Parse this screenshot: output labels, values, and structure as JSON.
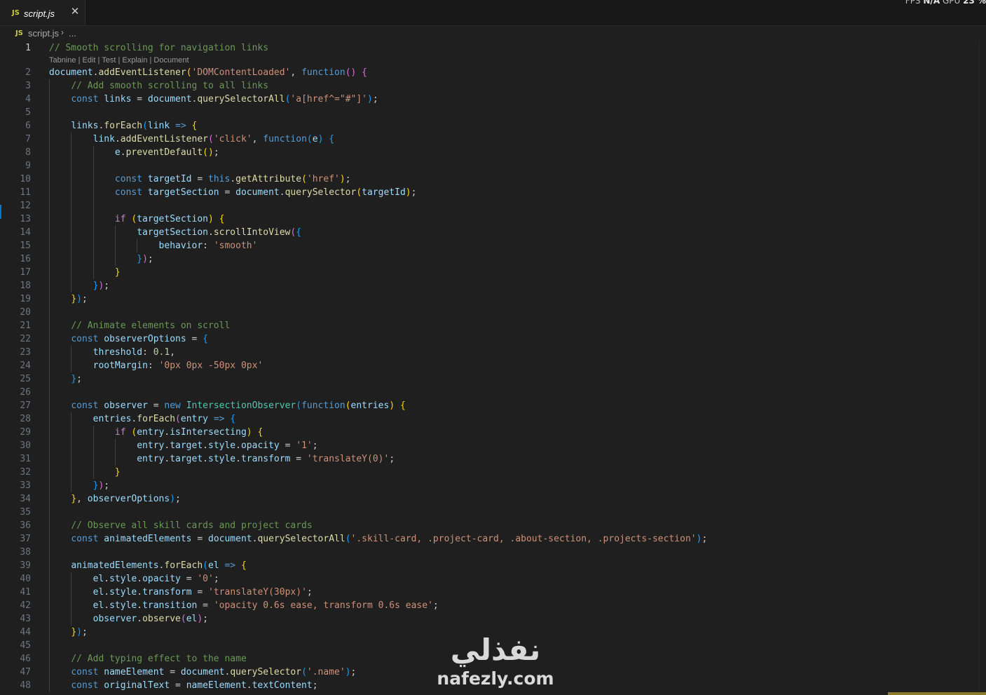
{
  "tab": {
    "label": "script.js",
    "icon": "JS",
    "close": "✕"
  },
  "overlay": {
    "fps_label": "FPS",
    "fps_value": "N/A",
    "gpu_label": "GPU",
    "gpu_value": "23 %"
  },
  "breadcrumb": {
    "icon": "JS",
    "file": "script.js",
    "separator": "›",
    "more": "..."
  },
  "codelens": "Tabnine | Edit | Test | Explain | Document",
  "watermark": {
    "arabic": "نفذلي",
    "latin": "nafezly.com"
  },
  "colors": {
    "comment": "#6a9955",
    "keyword": "#569cd6",
    "function": "#dcdcaa",
    "variable": "#9cdcfe",
    "string": "#ce9178",
    "number": "#b5cea8",
    "class": "#4ec9b0",
    "control": "#c586c0",
    "bracket_1": "#ffd700",
    "bracket_2": "#da70d6",
    "bracket_3": "#179fff",
    "text": "#cccccc"
  },
  "lines": [
    {
      "n": "1",
      "t": [
        [
          "com",
          "// Smooth scrolling for navigation links"
        ]
      ]
    },
    {
      "n": "2",
      "t": [
        [
          "var",
          "document"
        ],
        [
          "txt",
          "."
        ],
        [
          "fn",
          "addEventListener"
        ],
        [
          "b1",
          "("
        ],
        [
          "str",
          "'DOMContentLoaded'"
        ],
        [
          "txt",
          ", "
        ],
        [
          "kw",
          "function"
        ],
        [
          "b2",
          "()"
        ],
        [
          "txt",
          " "
        ],
        [
          "b2",
          "{"
        ]
      ]
    },
    {
      "n": "3",
      "t": [
        [
          "txt",
          "    "
        ],
        [
          "com",
          "// Add smooth scrolling to all links"
        ]
      ]
    },
    {
      "n": "4",
      "t": [
        [
          "txt",
          "    "
        ],
        [
          "kw",
          "const"
        ],
        [
          "txt",
          " "
        ],
        [
          "var",
          "links"
        ],
        [
          "txt",
          " = "
        ],
        [
          "var",
          "document"
        ],
        [
          "txt",
          "."
        ],
        [
          "fn",
          "querySelectorAll"
        ],
        [
          "b3",
          "("
        ],
        [
          "str",
          "'a[href^=\"#\"]'"
        ],
        [
          "b3",
          ")"
        ],
        [
          "txt",
          ";"
        ]
      ]
    },
    {
      "n": "5",
      "t": []
    },
    {
      "n": "6",
      "t": [
        [
          "txt",
          "    "
        ],
        [
          "var",
          "links"
        ],
        [
          "txt",
          "."
        ],
        [
          "fn",
          "forEach"
        ],
        [
          "b3",
          "("
        ],
        [
          "var",
          "link"
        ],
        [
          "txt",
          " "
        ],
        [
          "kw",
          "=>"
        ],
        [
          "txt",
          " "
        ],
        [
          "b1",
          "{"
        ]
      ]
    },
    {
      "n": "7",
      "t": [
        [
          "txt",
          "        "
        ],
        [
          "var",
          "link"
        ],
        [
          "txt",
          "."
        ],
        [
          "fn",
          "addEventListener"
        ],
        [
          "b2",
          "("
        ],
        [
          "str",
          "'click'"
        ],
        [
          "txt",
          ", "
        ],
        [
          "kw",
          "function"
        ],
        [
          "b3",
          "("
        ],
        [
          "var",
          "e"
        ],
        [
          "b3",
          ")"
        ],
        [
          "txt",
          " "
        ],
        [
          "b3",
          "{"
        ]
      ]
    },
    {
      "n": "8",
      "t": [
        [
          "txt",
          "            "
        ],
        [
          "var",
          "e"
        ],
        [
          "txt",
          "."
        ],
        [
          "fn",
          "preventDefault"
        ],
        [
          "b1",
          "()"
        ],
        [
          "txt",
          ";"
        ]
      ]
    },
    {
      "n": "9",
      "t": []
    },
    {
      "n": "10",
      "t": [
        [
          "txt",
          "            "
        ],
        [
          "kw",
          "const"
        ],
        [
          "txt",
          " "
        ],
        [
          "var",
          "targetId"
        ],
        [
          "txt",
          " = "
        ],
        [
          "kw",
          "this"
        ],
        [
          "txt",
          "."
        ],
        [
          "fn",
          "getAttribute"
        ],
        [
          "b1",
          "("
        ],
        [
          "str",
          "'href'"
        ],
        [
          "b1",
          ")"
        ],
        [
          "txt",
          ";"
        ]
      ]
    },
    {
      "n": "11",
      "t": [
        [
          "txt",
          "            "
        ],
        [
          "kw",
          "const"
        ],
        [
          "txt",
          " "
        ],
        [
          "var",
          "targetSection"
        ],
        [
          "txt",
          " = "
        ],
        [
          "var",
          "document"
        ],
        [
          "txt",
          "."
        ],
        [
          "fn",
          "querySelector"
        ],
        [
          "b1",
          "("
        ],
        [
          "var",
          "targetId"
        ],
        [
          "b1",
          ")"
        ],
        [
          "txt",
          ";"
        ]
      ]
    },
    {
      "n": "12",
      "t": []
    },
    {
      "n": "13",
      "t": [
        [
          "txt",
          "            "
        ],
        [
          "ctl",
          "if"
        ],
        [
          "txt",
          " "
        ],
        [
          "b1",
          "("
        ],
        [
          "var",
          "targetSection"
        ],
        [
          "b1",
          ")"
        ],
        [
          "txt",
          " "
        ],
        [
          "b1",
          "{"
        ]
      ]
    },
    {
      "n": "14",
      "t": [
        [
          "txt",
          "                "
        ],
        [
          "var",
          "targetSection"
        ],
        [
          "txt",
          "."
        ],
        [
          "fn",
          "scrollIntoView"
        ],
        [
          "b2",
          "("
        ],
        [
          "b3",
          "{"
        ]
      ]
    },
    {
      "n": "15",
      "t": [
        [
          "txt",
          "                    "
        ],
        [
          "var",
          "behavior"
        ],
        [
          "txt",
          ": "
        ],
        [
          "str",
          "'smooth'"
        ]
      ]
    },
    {
      "n": "16",
      "t": [
        [
          "txt",
          "                "
        ],
        [
          "b3",
          "}"
        ],
        [
          "b2",
          ")"
        ],
        [
          "txt",
          ";"
        ]
      ]
    },
    {
      "n": "17",
      "t": [
        [
          "txt",
          "            "
        ],
        [
          "b1",
          "}"
        ]
      ]
    },
    {
      "n": "18",
      "t": [
        [
          "txt",
          "        "
        ],
        [
          "b3",
          "}"
        ],
        [
          "b2",
          ")"
        ],
        [
          "txt",
          ";"
        ]
      ]
    },
    {
      "n": "19",
      "t": [
        [
          "txt",
          "    "
        ],
        [
          "b1",
          "}"
        ],
        [
          "b3",
          ")"
        ],
        [
          "txt",
          ";"
        ]
      ]
    },
    {
      "n": "20",
      "t": []
    },
    {
      "n": "21",
      "t": [
        [
          "txt",
          "    "
        ],
        [
          "com",
          "// Animate elements on scroll"
        ]
      ]
    },
    {
      "n": "22",
      "t": [
        [
          "txt",
          "    "
        ],
        [
          "kw",
          "const"
        ],
        [
          "txt",
          " "
        ],
        [
          "var",
          "observerOptions"
        ],
        [
          "txt",
          " = "
        ],
        [
          "b3",
          "{"
        ]
      ]
    },
    {
      "n": "23",
      "t": [
        [
          "txt",
          "        "
        ],
        [
          "var",
          "threshold"
        ],
        [
          "txt",
          ": "
        ],
        [
          "num",
          "0.1"
        ],
        [
          "txt",
          ","
        ]
      ]
    },
    {
      "n": "24",
      "t": [
        [
          "txt",
          "        "
        ],
        [
          "var",
          "rootMargin"
        ],
        [
          "txt",
          ": "
        ],
        [
          "str",
          "'0px 0px -50px 0px'"
        ]
      ]
    },
    {
      "n": "25",
      "t": [
        [
          "txt",
          "    "
        ],
        [
          "b3",
          "}"
        ],
        [
          "txt",
          ";"
        ]
      ]
    },
    {
      "n": "26",
      "t": []
    },
    {
      "n": "27",
      "t": [
        [
          "txt",
          "    "
        ],
        [
          "kw",
          "const"
        ],
        [
          "txt",
          " "
        ],
        [
          "var",
          "observer"
        ],
        [
          "txt",
          " = "
        ],
        [
          "kw",
          "new"
        ],
        [
          "txt",
          " "
        ],
        [
          "cls",
          "IntersectionObserver"
        ],
        [
          "b3",
          "("
        ],
        [
          "kw",
          "function"
        ],
        [
          "b1",
          "("
        ],
        [
          "var",
          "entries"
        ],
        [
          "b1",
          ")"
        ],
        [
          "txt",
          " "
        ],
        [
          "b1",
          "{"
        ]
      ]
    },
    {
      "n": "28",
      "t": [
        [
          "txt",
          "        "
        ],
        [
          "var",
          "entries"
        ],
        [
          "txt",
          "."
        ],
        [
          "fn",
          "forEach"
        ],
        [
          "b2",
          "("
        ],
        [
          "var",
          "entry"
        ],
        [
          "txt",
          " "
        ],
        [
          "kw",
          "=>"
        ],
        [
          "txt",
          " "
        ],
        [
          "b3",
          "{"
        ]
      ]
    },
    {
      "n": "29",
      "t": [
        [
          "txt",
          "            "
        ],
        [
          "ctl",
          "if"
        ],
        [
          "txt",
          " "
        ],
        [
          "b1",
          "("
        ],
        [
          "var",
          "entry"
        ],
        [
          "txt",
          "."
        ],
        [
          "var",
          "isIntersecting"
        ],
        [
          "b1",
          ")"
        ],
        [
          "txt",
          " "
        ],
        [
          "b1",
          "{"
        ]
      ]
    },
    {
      "n": "30",
      "t": [
        [
          "txt",
          "                "
        ],
        [
          "var",
          "entry"
        ],
        [
          "txt",
          "."
        ],
        [
          "var",
          "target"
        ],
        [
          "txt",
          "."
        ],
        [
          "var",
          "style"
        ],
        [
          "txt",
          "."
        ],
        [
          "var",
          "opacity"
        ],
        [
          "txt",
          " = "
        ],
        [
          "str",
          "'1'"
        ],
        [
          "txt",
          ";"
        ]
      ]
    },
    {
      "n": "31",
      "t": [
        [
          "txt",
          "                "
        ],
        [
          "var",
          "entry"
        ],
        [
          "txt",
          "."
        ],
        [
          "var",
          "target"
        ],
        [
          "txt",
          "."
        ],
        [
          "var",
          "style"
        ],
        [
          "txt",
          "."
        ],
        [
          "var",
          "transform"
        ],
        [
          "txt",
          " = "
        ],
        [
          "str",
          "'translateY(0)'"
        ],
        [
          "txt",
          ";"
        ]
      ]
    },
    {
      "n": "32",
      "t": [
        [
          "txt",
          "            "
        ],
        [
          "b1",
          "}"
        ]
      ]
    },
    {
      "n": "33",
      "t": [
        [
          "txt",
          "        "
        ],
        [
          "b3",
          "}"
        ],
        [
          "b2",
          ")"
        ],
        [
          "txt",
          ";"
        ]
      ]
    },
    {
      "n": "34",
      "t": [
        [
          "txt",
          "    "
        ],
        [
          "b1",
          "}"
        ],
        [
          "txt",
          ", "
        ],
        [
          "var",
          "observerOptions"
        ],
        [
          "b3",
          ")"
        ],
        [
          "txt",
          ";"
        ]
      ]
    },
    {
      "n": "35",
      "t": []
    },
    {
      "n": "36",
      "t": [
        [
          "txt",
          "    "
        ],
        [
          "com",
          "// Observe all skill cards and project cards"
        ]
      ]
    },
    {
      "n": "37",
      "t": [
        [
          "txt",
          "    "
        ],
        [
          "kw",
          "const"
        ],
        [
          "txt",
          " "
        ],
        [
          "var",
          "animatedElements"
        ],
        [
          "txt",
          " = "
        ],
        [
          "var",
          "document"
        ],
        [
          "txt",
          "."
        ],
        [
          "fn",
          "querySelectorAll"
        ],
        [
          "b3",
          "("
        ],
        [
          "str",
          "'.skill-card, .project-card, .about-section, .projects-section'"
        ],
        [
          "b3",
          ")"
        ],
        [
          "txt",
          ";"
        ]
      ]
    },
    {
      "n": "38",
      "t": []
    },
    {
      "n": "39",
      "t": [
        [
          "txt",
          "    "
        ],
        [
          "var",
          "animatedElements"
        ],
        [
          "txt",
          "."
        ],
        [
          "fn",
          "forEach"
        ],
        [
          "b3",
          "("
        ],
        [
          "var",
          "el"
        ],
        [
          "txt",
          " "
        ],
        [
          "kw",
          "=>"
        ],
        [
          "txt",
          " "
        ],
        [
          "b1",
          "{"
        ]
      ]
    },
    {
      "n": "40",
      "t": [
        [
          "txt",
          "        "
        ],
        [
          "var",
          "el"
        ],
        [
          "txt",
          "."
        ],
        [
          "var",
          "style"
        ],
        [
          "txt",
          "."
        ],
        [
          "var",
          "opacity"
        ],
        [
          "txt",
          " = "
        ],
        [
          "str",
          "'0'"
        ],
        [
          "txt",
          ";"
        ]
      ]
    },
    {
      "n": "41",
      "t": [
        [
          "txt",
          "        "
        ],
        [
          "var",
          "el"
        ],
        [
          "txt",
          "."
        ],
        [
          "var",
          "style"
        ],
        [
          "txt",
          "."
        ],
        [
          "var",
          "transform"
        ],
        [
          "txt",
          " = "
        ],
        [
          "str",
          "'translateY(30px)'"
        ],
        [
          "txt",
          ";"
        ]
      ]
    },
    {
      "n": "42",
      "t": [
        [
          "txt",
          "        "
        ],
        [
          "var",
          "el"
        ],
        [
          "txt",
          "."
        ],
        [
          "var",
          "style"
        ],
        [
          "txt",
          "."
        ],
        [
          "var",
          "transition"
        ],
        [
          "txt",
          " = "
        ],
        [
          "str",
          "'opacity 0.6s ease, transform 0.6s ease'"
        ],
        [
          "txt",
          ";"
        ]
      ]
    },
    {
      "n": "43",
      "t": [
        [
          "txt",
          "        "
        ],
        [
          "var",
          "observer"
        ],
        [
          "txt",
          "."
        ],
        [
          "fn",
          "observe"
        ],
        [
          "b2",
          "("
        ],
        [
          "var",
          "el"
        ],
        [
          "b2",
          ")"
        ],
        [
          "txt",
          ";"
        ]
      ]
    },
    {
      "n": "44",
      "t": [
        [
          "txt",
          "    "
        ],
        [
          "b1",
          "}"
        ],
        [
          "b3",
          ")"
        ],
        [
          "txt",
          ";"
        ]
      ]
    },
    {
      "n": "45",
      "t": []
    },
    {
      "n": "46",
      "t": [
        [
          "txt",
          "    "
        ],
        [
          "com",
          "// Add typing effect to the name"
        ]
      ]
    },
    {
      "n": "47",
      "t": [
        [
          "txt",
          "    "
        ],
        [
          "kw",
          "const"
        ],
        [
          "txt",
          " "
        ],
        [
          "var",
          "nameElement"
        ],
        [
          "txt",
          " = "
        ],
        [
          "var",
          "document"
        ],
        [
          "txt",
          "."
        ],
        [
          "fn",
          "querySelector"
        ],
        [
          "b3",
          "("
        ],
        [
          "str",
          "'.name'"
        ],
        [
          "b3",
          ")"
        ],
        [
          "txt",
          ";"
        ]
      ]
    },
    {
      "n": "48",
      "t": [
        [
          "txt",
          "    "
        ],
        [
          "kw",
          "const"
        ],
        [
          "txt",
          " "
        ],
        [
          "var",
          "originalText"
        ],
        [
          "txt",
          " = "
        ],
        [
          "var",
          "nameElement"
        ],
        [
          "txt",
          "."
        ],
        [
          "var",
          "textContent"
        ],
        [
          "txt",
          ";"
        ]
      ]
    }
  ]
}
